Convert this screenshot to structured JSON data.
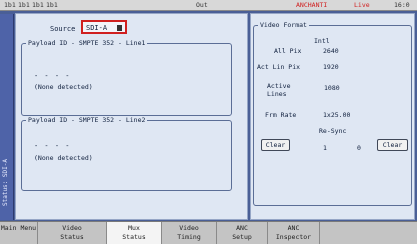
{
  "statusbar": {
    "items": [
      "1b1",
      "1b1",
      "1b1",
      "1b1",
      "Out",
      "ANCHANTI",
      "Live",
      "16:0"
    ]
  },
  "sidebar": {
    "label": "Status: SDI-A"
  },
  "source": {
    "label": "Source",
    "value": "SDI-A"
  },
  "payload1": {
    "title": "Payload ID - SMPTE 352 - Line1",
    "dashes": "- - - -",
    "status": "(None detected)"
  },
  "payload2": {
    "title": "Payload ID - SMPTE 352 - Line2",
    "dashes": "- - - -",
    "status": "(None detected)"
  },
  "video_format": {
    "title": "Video Format",
    "intl": "Intl",
    "all_pix_label": "All Pix",
    "all_pix_value": "2640",
    "act_lin_pix_label": "Act Lin Pix",
    "act_lin_pix_value": "1920",
    "active_lines_label": "Active Lines",
    "active_lines_value": "1080",
    "frm_rate_label": "Frm Rate",
    "frm_rate_value": "1x25.00",
    "resync_label": "Re-Sync",
    "clear1_label": "Clear",
    "count1": "1",
    "count2": "0",
    "clear2_label": "Clear"
  },
  "bottom_menu": [
    {
      "label": "Main Menu"
    },
    {
      "label": "Video\nStatus"
    },
    {
      "label": "Mux\nStatus",
      "active": true
    },
    {
      "label": "Video\nTiming"
    },
    {
      "label": "ANC\nSetup"
    },
    {
      "label": "ANC\nInspector"
    },
    {
      "label": ""
    }
  ]
}
